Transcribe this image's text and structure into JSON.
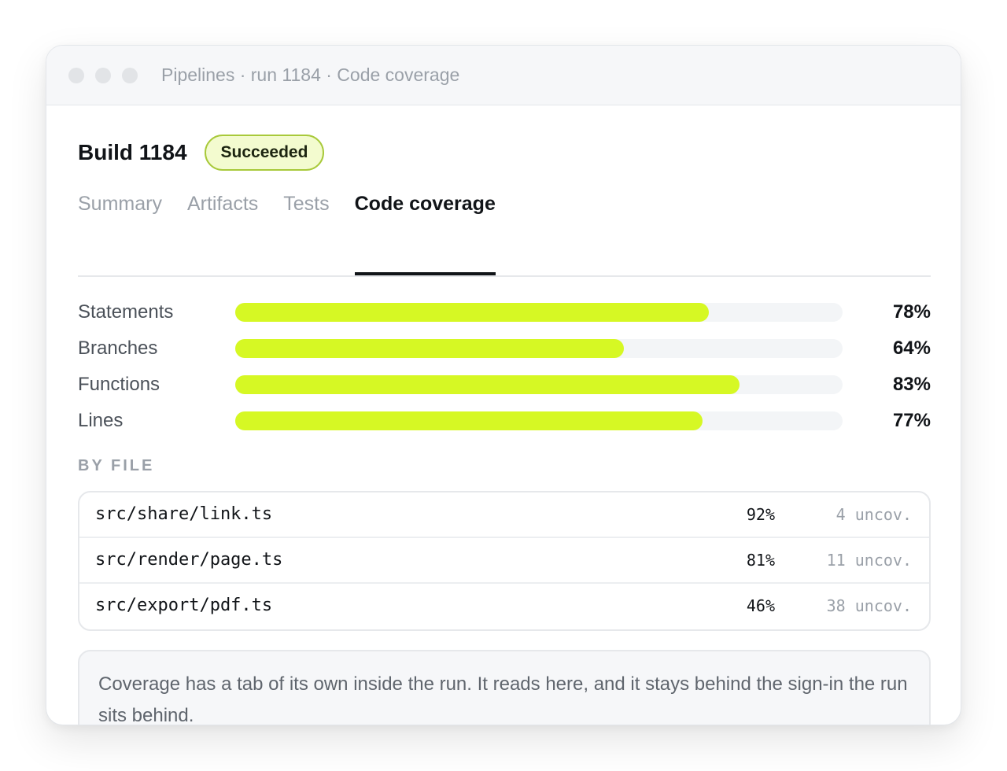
{
  "window": {
    "breadcrumb": "Pipelines · run 1184 · Code coverage"
  },
  "build": {
    "title": "Build 1184",
    "status": "Succeeded"
  },
  "tabs": [
    {
      "label": "Summary",
      "active": false
    },
    {
      "label": "Artifacts",
      "active": false
    },
    {
      "label": "Tests",
      "active": false
    },
    {
      "label": "Code coverage",
      "active": true
    }
  ],
  "metrics": [
    {
      "label": "Statements",
      "percent": 78,
      "display": "78%"
    },
    {
      "label": "Branches",
      "percent": 64,
      "display": "64%"
    },
    {
      "label": "Functions",
      "percent": 83,
      "display": "83%"
    },
    {
      "label": "Lines",
      "percent": 77,
      "display": "77%"
    }
  ],
  "by_file": {
    "heading": "BY FILE",
    "rows": [
      {
        "path": "src/share/link.ts",
        "coverage": "92%",
        "uncovered": "4 uncov."
      },
      {
        "path": "src/render/page.ts",
        "coverage": "81%",
        "uncovered": "11 uncov."
      },
      {
        "path": "src/export/pdf.ts",
        "coverage": "46%",
        "uncovered": "38 uncov."
      }
    ]
  },
  "note": "Coverage has a tab of its own inside the run. It reads here, and it stays behind the sign-in the run sits behind.",
  "colors": {
    "accent_fill": "#d6f824",
    "badge_border": "#a8c93a",
    "badge_bg": "#f3fbcf"
  }
}
